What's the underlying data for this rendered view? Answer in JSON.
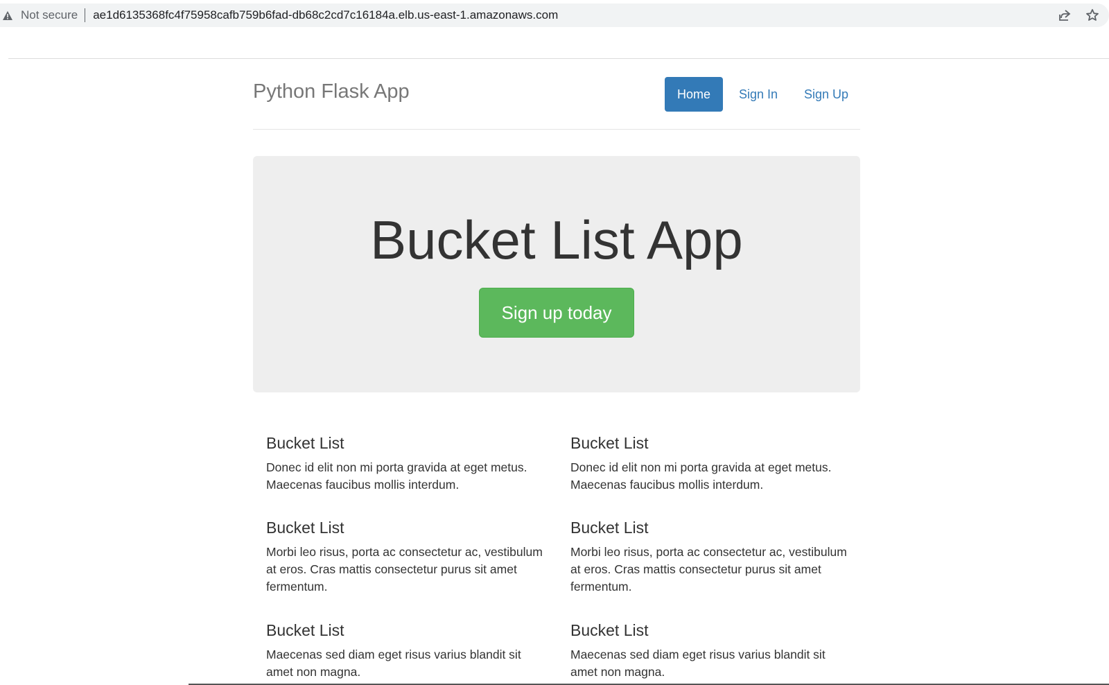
{
  "browser": {
    "security_label": "Not secure",
    "url": "ae1d6135368fc4f75958cafb759b6fad-db68c2cd7c16184a.elb.us-east-1.amazonaws.com"
  },
  "header": {
    "brand": "Python Flask App",
    "nav": [
      {
        "label": "Home",
        "active": true
      },
      {
        "label": "Sign In",
        "active": false
      },
      {
        "label": "Sign Up",
        "active": false
      }
    ]
  },
  "jumbotron": {
    "title": "Bucket List App",
    "cta_label": "Sign up today"
  },
  "cards": [
    {
      "title": "Bucket List",
      "text": "Donec id elit non mi porta gravida at eget metus. Maecenas faucibus mollis interdum."
    },
    {
      "title": "Bucket List",
      "text": "Donec id elit non mi porta gravida at eget metus. Maecenas faucibus mollis interdum."
    },
    {
      "title": "Bucket List",
      "text": "Morbi leo risus, porta ac consectetur ac, vestibulum at eros. Cras mattis consectetur purus sit amet fermentum."
    },
    {
      "title": "Bucket List",
      "text": "Morbi leo risus, porta ac consectetur ac, vestibulum at eros. Cras mattis consectetur purus sit amet fermentum."
    },
    {
      "title": "Bucket List",
      "text": "Maecenas sed diam eget risus varius blandit sit amet non magna."
    },
    {
      "title": "Bucket List",
      "text": "Maecenas sed diam eget risus varius blandit sit amet non magna."
    }
  ],
  "colors": {
    "primary": "#337ab7",
    "success": "#5cb85c",
    "jumbotron_bg": "#eeeeee"
  },
  "icons": {
    "security": "warning-triangle-icon",
    "share": "share-icon",
    "bookmark": "star-icon"
  }
}
